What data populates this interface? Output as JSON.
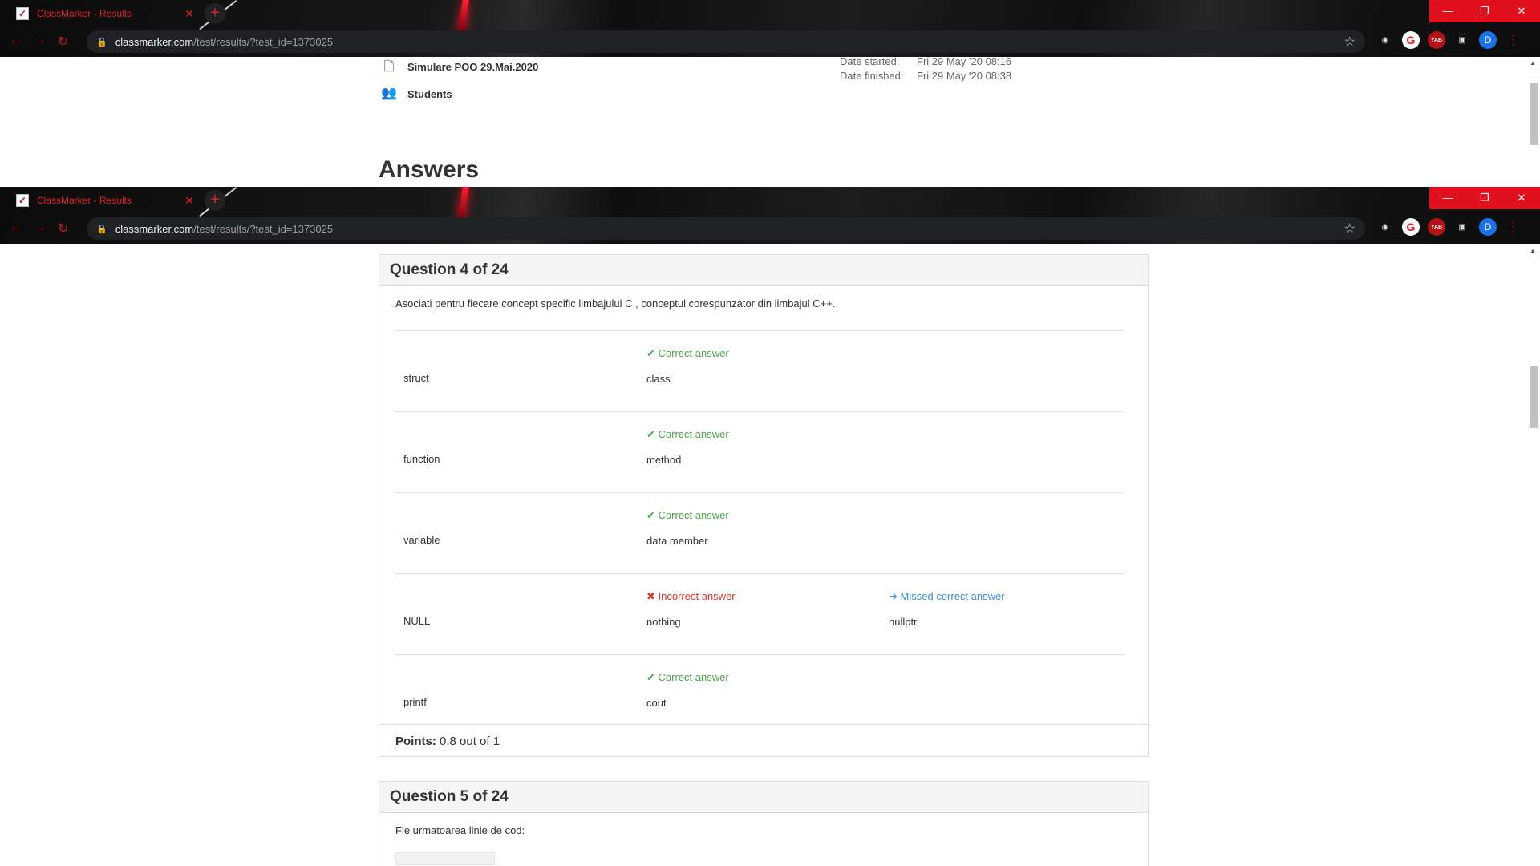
{
  "browser": {
    "tab_title": "ClassMarker - Results",
    "tab_close": "✕",
    "new_tab": "+",
    "url_host": "classmarker.com",
    "url_path": "/test/results/?test_id=1373025",
    "avatar_letter": "D",
    "yab_label": "YAB",
    "minimize": "—",
    "restore": "❐",
    "close": "✕"
  },
  "info": {
    "test_name": "Simulare POO 29.Mai.2020",
    "group": "Students",
    "date_started_label": "Date started:",
    "date_started": "Fri 29 May '20 08:16",
    "date_finished_label": "Date finished:",
    "date_finished": "Fri 29 May '20 08:38"
  },
  "answers_title": "Answers",
  "question4": {
    "header": "Question 4 of 24",
    "text": "Asociati pentru fiecare concept specific limbajului C , conceptul corespunzator din limbajul C++.",
    "rows": [
      {
        "left": "struct",
        "status": "Correct answer",
        "answer": "class"
      },
      {
        "left": "function",
        "status": "Correct answer",
        "answer": "method"
      },
      {
        "left": "variable",
        "status": "Correct answer",
        "answer": "data member"
      },
      {
        "left": "NULL",
        "status": "Incorrect answer",
        "answer": "nothing",
        "missed_label": "Missed correct answer",
        "missed_value": "nullptr"
      },
      {
        "left": "printf",
        "status": "Correct answer",
        "answer": "cout"
      }
    ],
    "points_label": "Points:",
    "points_value": "0.8 out of 1"
  },
  "question5": {
    "header": "Question 5 of 24",
    "text": "Fie urmatoarea linie de cod:"
  },
  "colors": {
    "correct": "#4aa54a",
    "incorrect": "#d9362b",
    "missed": "#3b8ed8",
    "window_controls": "#e0101e"
  },
  "icons": {
    "correct": "check-icon",
    "incorrect": "x-icon",
    "missed": "arrow-right-icon"
  }
}
